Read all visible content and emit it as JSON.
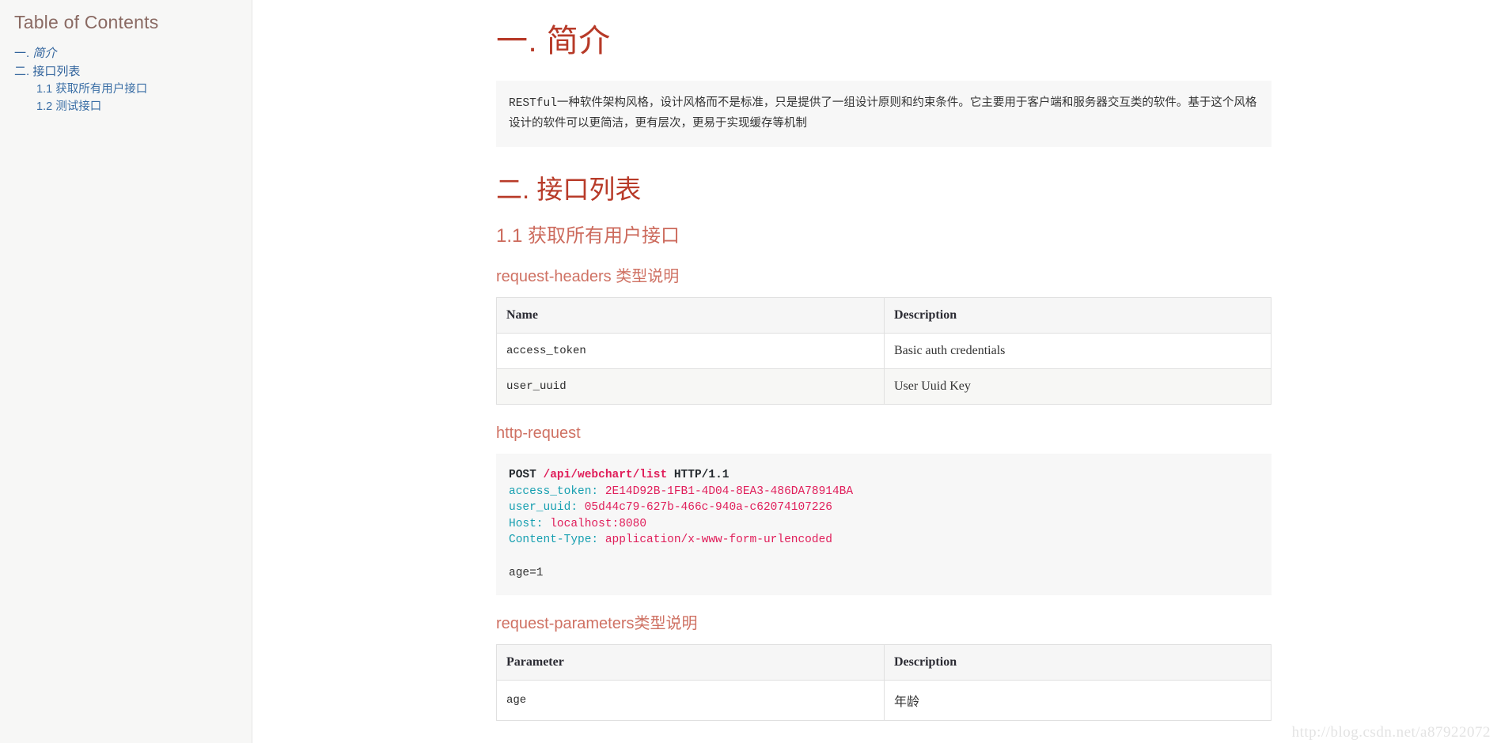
{
  "sidebar": {
    "title": "Table of Contents",
    "items": [
      {
        "num": "一.",
        "label": "简介",
        "level": 1,
        "italic": true
      },
      {
        "num": "二.",
        "label": "接口列表",
        "level": 1,
        "italic": false
      },
      {
        "num": "1.1",
        "label": "获取所有用户接口",
        "level": 2,
        "italic": false
      },
      {
        "num": "1.2",
        "label": "测试接口",
        "level": 2,
        "italic": false
      }
    ]
  },
  "content": {
    "h1_intro": "一. 简介",
    "intro_quote_code": "RESTful",
    "intro_quote_text": "一种软件架构风格，设计风格而不是标准，只是提供了一组设计原则和约束条件。它主要用于客户端和服务器交互类的软件。基于这个风格设计的软件可以更简洁，更有层次，更易于实现缓存等机制",
    "h2_api_list": "二. 接口列表",
    "h3_get_all_users": "1.1 获取所有用户接口",
    "h4_request_headers": "request-headers 类型说明",
    "headers_table": {
      "columns": [
        "Name",
        "Description"
      ],
      "rows": [
        {
          "name": "access_token",
          "description": "Basic auth credentials"
        },
        {
          "name": "user_uuid",
          "description": "User Uuid Key"
        }
      ]
    },
    "h4_http_request": "http-request",
    "code_block": {
      "line1": {
        "method": "POST",
        "path": "/api/webchart/list",
        "version": "HTTP/1.1"
      },
      "line2": {
        "header": "access_token:",
        "value": "2E14D92B-1FB1-4D04-8EA3-486DA78914BA"
      },
      "line3": {
        "header": "user_uuid:",
        "value": "05d44c79-627b-466c-940a-c62074107226"
      },
      "line4": {
        "header": "Host:",
        "value": "localhost:8080"
      },
      "line5": {
        "header": "Content-Type:",
        "value": "application/x-www-form-urlencoded"
      },
      "line6": "",
      "line7": "age=1"
    },
    "h4_request_parameters": "request-parameters类型说明",
    "parameters_table": {
      "columns": [
        "Parameter",
        "Description"
      ],
      "rows": [
        {
          "name": "age",
          "description": "年龄"
        }
      ]
    }
  },
  "watermark": "http://blog.csdn.net/a87922072",
  "colors": {
    "heading_primary": "#b73a28",
    "heading_secondary": "#cc6a5c",
    "toc_link": "#31639c",
    "toc_title": "#8a6a63",
    "code_header": "#169fb0",
    "code_value": "#e01e5a",
    "panel_bg": "#f7f7f7",
    "sidebar_bg": "#f7f7f6"
  }
}
